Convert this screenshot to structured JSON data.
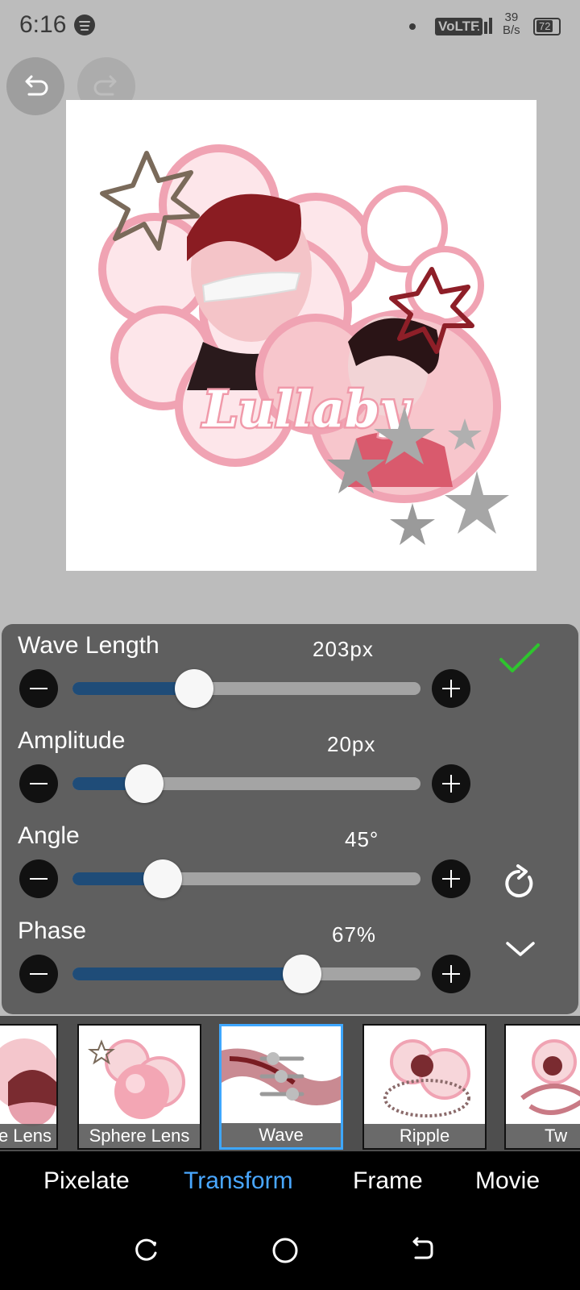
{
  "status_bar": {
    "time": "6:16",
    "volte": "VoLTE",
    "speed_value": "39",
    "speed_unit": "B/s",
    "battery": "72"
  },
  "toolbar": {
    "undo_icon": "undo-icon",
    "redo_icon": "redo-icon"
  },
  "canvas": {
    "artwork_text": "Lullaby"
  },
  "sliders": [
    {
      "label": "Wave Length",
      "value": "203px",
      "level": 0.35
    },
    {
      "label": "Amplitude",
      "value": "20px",
      "level": 0.205
    },
    {
      "label": "Angle",
      "value": "45°",
      "level": 0.26
    },
    {
      "label": "Phase",
      "value": "67%",
      "level": 0.66
    }
  ],
  "panel_actions": {
    "confirm_icon": "check-icon",
    "reset_icon": "refresh-icon",
    "collapse_icon": "chevron-down-icon"
  },
  "effects": [
    {
      "label": "e Lens"
    },
    {
      "label": "Sphere Lens"
    },
    {
      "label": "Wave",
      "selected": true
    },
    {
      "label": "Ripple"
    },
    {
      "label": "Tw"
    }
  ],
  "tabs": [
    {
      "label": "Pixelate"
    },
    {
      "label": "Transform",
      "active": true
    },
    {
      "label": "Frame"
    },
    {
      "label": "Movie"
    }
  ],
  "colors": {
    "accent": "#49a7ff",
    "slider_fill": "#1f4c78",
    "confirm": "#2ec52e",
    "pink": "#f0a3b3"
  }
}
